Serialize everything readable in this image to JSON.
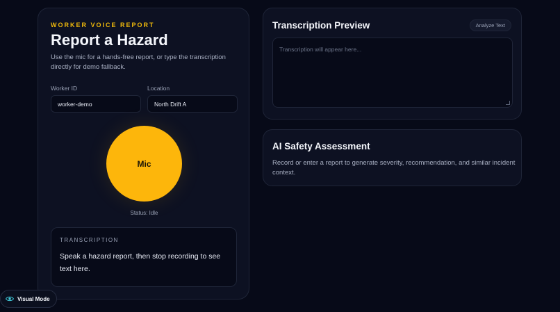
{
  "hazard": {
    "eyebrow": "WORKER VOICE REPORT",
    "title": "Report a Hazard",
    "description": "Use the mic for a hands-free report, or type the transcription directly for demo fallback.",
    "worker_id_label": "Worker ID",
    "worker_id_value": "worker-demo",
    "location_label": "Location",
    "location_value": "North Drift A",
    "mic_label": "Mic",
    "status": "Status: Idle",
    "transcription_label": "TRANSCRIPTION",
    "transcription_text": "Speak a hazard report, then stop recording to see text here."
  },
  "preview": {
    "title": "Transcription Preview",
    "analyze_label": "Analyze Text",
    "placeholder": "Transcription will appear here..."
  },
  "assessment": {
    "title": "AI Safety Assessment",
    "description": "Record or enter a report to generate severity, recommendation, and similar incident context."
  },
  "footer": {
    "visual_mode_label": "Visual Mode",
    "visual_mode_icon": "eye-icon"
  },
  "colors": {
    "accent": "#fdb60b",
    "eyebrow": "#f0b90b",
    "background": "#070a18",
    "card": "#0d1122",
    "eye_icon": "#3fc6d6"
  }
}
